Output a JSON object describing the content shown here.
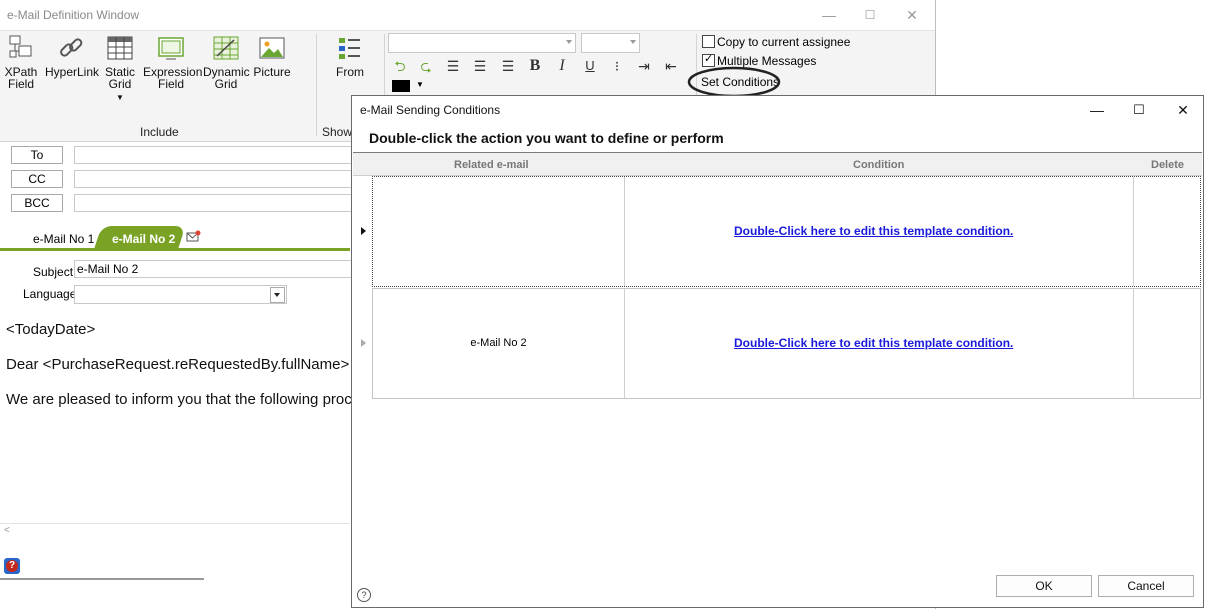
{
  "background_window": {
    "title": "e-Mail Definition Window",
    "controls": {
      "minimize": "—",
      "maximize": "☐",
      "close": "✕"
    },
    "ribbon": {
      "include_buttons": [
        {
          "label_line1": "XPath",
          "label_line2": "Field"
        },
        {
          "label_line1": "HyperLink",
          "label_line2": ""
        },
        {
          "label_line1": "Static",
          "label_line2": "Grid"
        },
        {
          "label_line1": "Expression",
          "label_line2": "Field"
        },
        {
          "label_line1": "Dynamic",
          "label_line2": "Grid"
        },
        {
          "label_line1": "Picture",
          "label_line2": ""
        }
      ],
      "include_label": "Include",
      "show_label": "Show",
      "from_label": "From",
      "font_name_value": "",
      "font_size_value": "",
      "copy_assignee_label": "Copy to current assignee",
      "copy_assignee_checked": false,
      "multiple_messages_label": "Multiple Messages",
      "multiple_messages_checked": true,
      "set_conditions_label": "Set Conditions"
    },
    "addresses": {
      "to": "To",
      "cc": "CC",
      "bcc": "BCC"
    },
    "tabs": [
      {
        "label": "e-Mail No  1"
      },
      {
        "label": "e-Mail No  2"
      }
    ],
    "subject_label": "Subject",
    "subject_value": "e-Mail No  2",
    "language_label": "Language:",
    "language_value": "",
    "body_lines": [
      "<TodayDate>",
      "Dear <PurchaseRequest.reRequestedBy.fullName>",
      "We are pleased to inform you that the following proc"
    ]
  },
  "dialog": {
    "title": "e-Mail Sending Conditions",
    "controls": {
      "minimize": "—",
      "maximize": "☐",
      "close": "✕"
    },
    "instruction": "Double-click the action you want to define or perform",
    "columns": [
      "Related e-mail",
      "Condition",
      "Delete"
    ],
    "rows": [
      {
        "related_email": "",
        "condition": "Double-Click here to edit this template condition.",
        "selected": true
      },
      {
        "related_email": "e-Mail No  2",
        "condition": "Double-Click here to edit this template condition.",
        "selected": false
      }
    ],
    "ok_label": "OK",
    "cancel_label": "Cancel",
    "help_glyph": "?"
  },
  "colors": {
    "active_tab": "#7aa326",
    "link": "#1a1adc",
    "help_icon": "#c4281d"
  }
}
